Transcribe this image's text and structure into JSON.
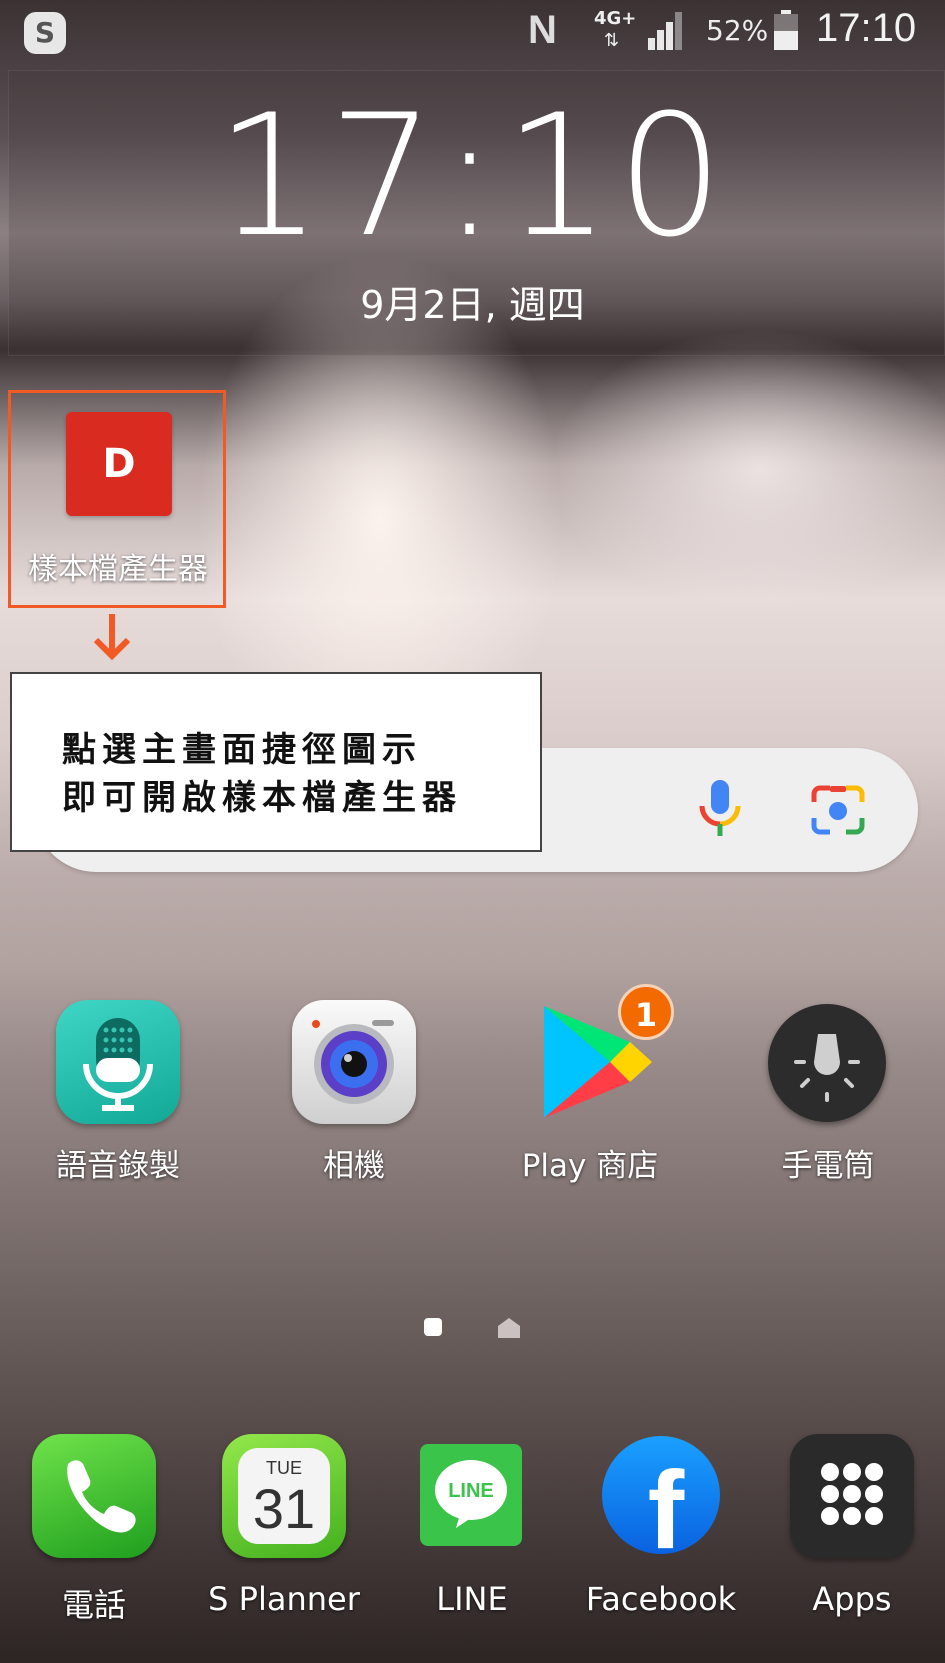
{
  "status_bar": {
    "app_badge": "S",
    "network": "N",
    "network_type": "4G+",
    "data_arrows": "⇅",
    "battery_percent": "52%",
    "battery_level": 0.52,
    "time": "17:10"
  },
  "clock_widget": {
    "time": "17:10",
    "date": "9月2日, 週四"
  },
  "shortcut": {
    "icon_letter": "D",
    "label": "樣本檔產生器",
    "highlight_color": "#f15a24"
  },
  "callout": {
    "line1": "點選主畫面捷徑圖示",
    "line2": "即可開啟樣本檔產生器"
  },
  "home_apps": [
    {
      "label": "語音錄製",
      "icon": "voice-recorder-icon"
    },
    {
      "label": "相機",
      "icon": "camera-icon"
    },
    {
      "label": "Play 商店",
      "icon": "play-store-icon",
      "badge": "1"
    },
    {
      "label": "手電筒",
      "icon": "flashlight-icon"
    }
  ],
  "dock": [
    {
      "label": "電話",
      "icon": "phone-icon"
    },
    {
      "label": "S Planner",
      "icon": "calendar-icon",
      "day": "TUE",
      "date": "31"
    },
    {
      "label": "LINE",
      "icon": "line-icon",
      "icon_text": "LINE"
    },
    {
      "label": "Facebook",
      "icon": "facebook-icon",
      "icon_text": "f"
    },
    {
      "label": "Apps",
      "icon": "apps-grid-icon"
    }
  ]
}
